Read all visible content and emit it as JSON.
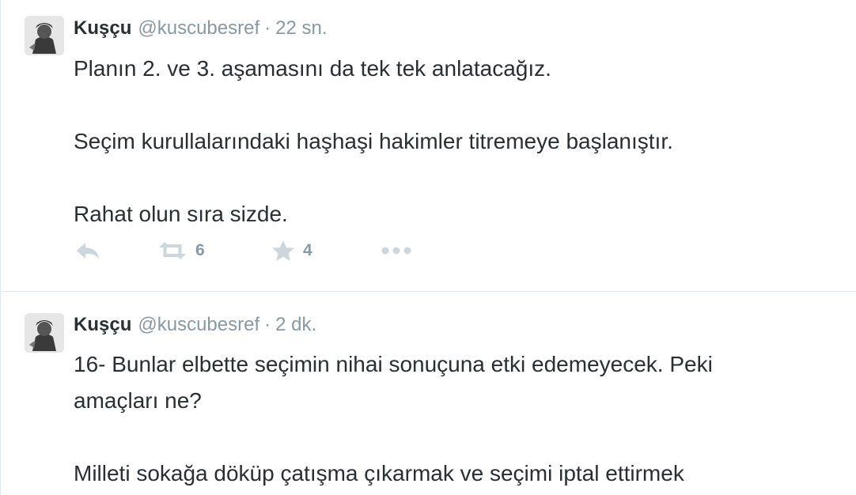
{
  "tweets": [
    {
      "name": "Kuşçu",
      "handle": "@kuscubesref",
      "separator": "·",
      "time": "22 sn.",
      "paragraphs": [
        "Planın 2. ve 3. aşamasını da tek tek anlatacağız.",
        "Seçim kurullalarındaki haşhaşi hakimler titremeye başlanıştır.",
        "Rahat olun sıra sizde."
      ],
      "retweet_count": "6",
      "favorite_count": "4",
      "icons": [
        "reply-icon",
        "retweet-icon",
        "favorite-icon",
        "more-icon"
      ]
    },
    {
      "name": "Kuşçu",
      "handle": "@kuscubesref",
      "separator": "·",
      "time": "2 dk.",
      "paragraphs": [
        "16- Bunlar elbette seçimin nihai sonuçuna etki edemeyecek. Peki",
        "amaçları ne?",
        "Milleti sokağa döküp çatışma çıkarmak ve seçimi iptal ettirmek"
      ]
    }
  ],
  "colors": {
    "text": "#292f33",
    "muted": "#8899a6",
    "icon": "#ccd6dd",
    "border": "#e1e8ed"
  }
}
